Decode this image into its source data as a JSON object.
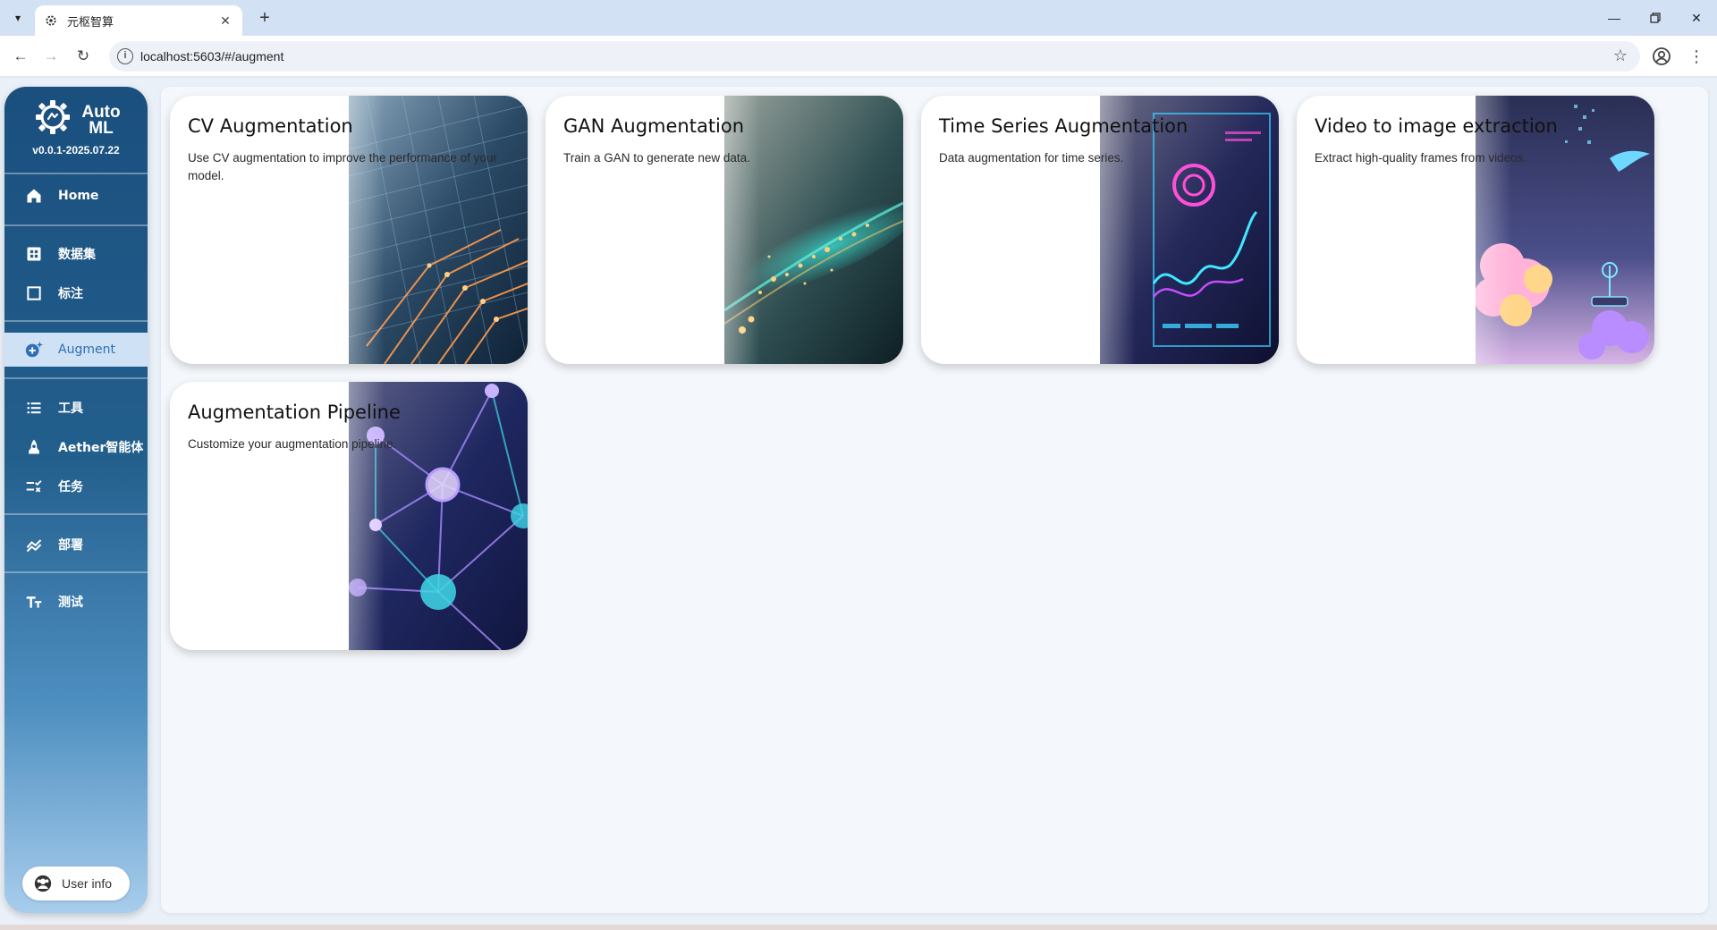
{
  "browser": {
    "tab_title": "元枢智算",
    "url": "localhost:5603/#/augment"
  },
  "sidebar": {
    "logo_text": "Auto ML",
    "version": "v0.0.1-2025.07.22",
    "items": [
      {
        "label": "Home",
        "icon": "home-icon"
      },
      {
        "label": "数据集",
        "icon": "grid-icon"
      },
      {
        "label": "标注",
        "icon": "square-icon"
      },
      {
        "label": "Augment",
        "icon": "sparkle-icon",
        "active": true
      },
      {
        "label": "工具",
        "icon": "list-icon"
      },
      {
        "label": "Aether智能体",
        "icon": "agent-icon"
      },
      {
        "label": "任务",
        "icon": "task-icon"
      },
      {
        "label": "部署",
        "icon": "chart-icon"
      },
      {
        "label": "测试",
        "icon": "text-icon"
      }
    ],
    "user_info": "User info"
  },
  "cards": [
    {
      "title": "CV Augmentation",
      "desc": "Use CV augmentation to improve the performance of your model."
    },
    {
      "title": "GAN Augmentation",
      "desc": "Train a GAN to generate new data."
    },
    {
      "title": "Time Series Augmentation",
      "desc": "Data augmentation for time series."
    },
    {
      "title": "Video to image extraction",
      "desc": "Extract high-quality frames from videos."
    },
    {
      "title": "Augmentation Pipeline",
      "desc": "Customize your augmentation pipeline."
    }
  ],
  "colors": {
    "sidebar_top": "#1a4f7e",
    "sidebar_bottom": "#a8cdec",
    "active_item_bg": "#cfe1f5",
    "active_item_text": "#2f6fb3"
  }
}
